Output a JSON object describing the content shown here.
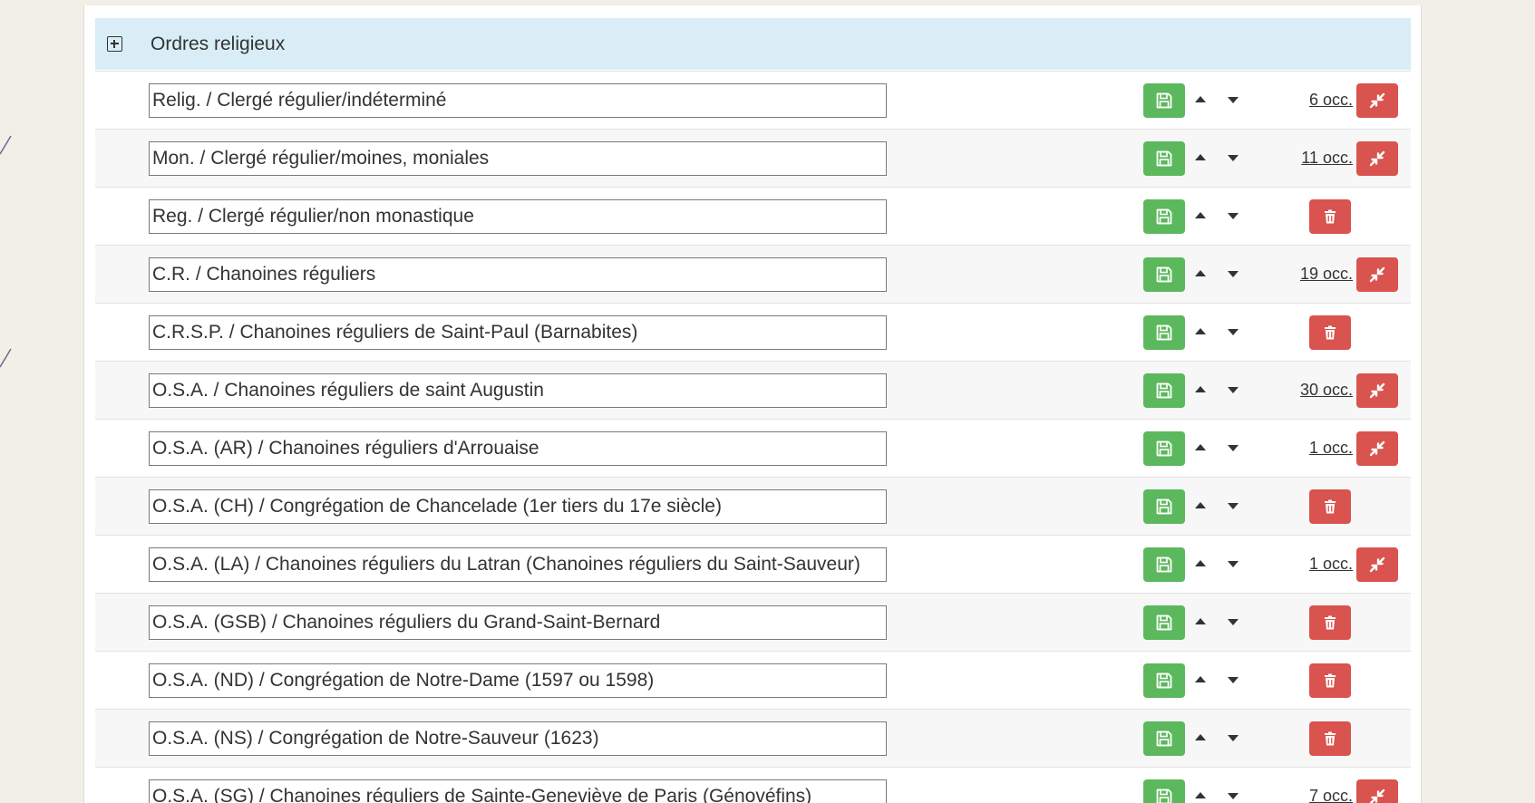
{
  "group": {
    "title": "Ordres religieux",
    "expand_icon": "plus-square-icon"
  },
  "colors": {
    "header_bg": "#d9edf7",
    "save_green": "#5cb85c",
    "danger_red": "#d9534f"
  },
  "rows": [
    {
      "value": "Relig. / Clergé régulier/indéterminé",
      "occ": "6 occ.",
      "action": "merge"
    },
    {
      "value": "Mon. / Clergé régulier/moines, moniales",
      "occ": "11 occ.",
      "action": "merge"
    },
    {
      "value": "Reg. / Clergé régulier/non monastique",
      "occ": "",
      "action": "delete"
    },
    {
      "value": "C.R. / Chanoines réguliers",
      "occ": "19 occ.",
      "action": "merge"
    },
    {
      "value": "C.R.S.P. / Chanoines réguliers de Saint-Paul (Barnabites)",
      "occ": "",
      "action": "delete"
    },
    {
      "value": "O.S.A. / Chanoines réguliers de saint Augustin",
      "occ": "30 occ.",
      "action": "merge"
    },
    {
      "value": "O.S.A. (AR) / Chanoines réguliers d'Arrouaise",
      "occ": "1 occ.",
      "action": "merge"
    },
    {
      "value": "O.S.A. (CH) / Congrégation de Chancelade (1er tiers du 17e siècle)",
      "occ": "",
      "action": "delete"
    },
    {
      "value": "O.S.A. (LA) / Chanoines réguliers du Latran (Chanoines réguliers du Saint-Sauveur)",
      "occ": "1 occ.",
      "action": "merge"
    },
    {
      "value": "O.S.A. (GSB) / Chanoines réguliers du Grand-Saint-Bernard",
      "occ": "",
      "action": "delete"
    },
    {
      "value": "O.S.A. (ND) / Congrégation de Notre-Dame (1597 ou 1598)",
      "occ": "",
      "action": "delete"
    },
    {
      "value": "O.S.A. (NS) / Congrégation de Notre-Sauveur (1623)",
      "occ": "",
      "action": "delete"
    },
    {
      "value": "O.S.A. (SG) / Chanoines réguliers de Sainte-Geneviève de Paris (Génovéfins)",
      "occ": "7 occ.",
      "action": "merge"
    }
  ],
  "icons": {
    "save": "floppy-disk-icon",
    "move_up": "caret-up-icon",
    "move_down": "caret-down-icon",
    "merge": "compress-arrows-icon",
    "delete": "trash-icon"
  }
}
